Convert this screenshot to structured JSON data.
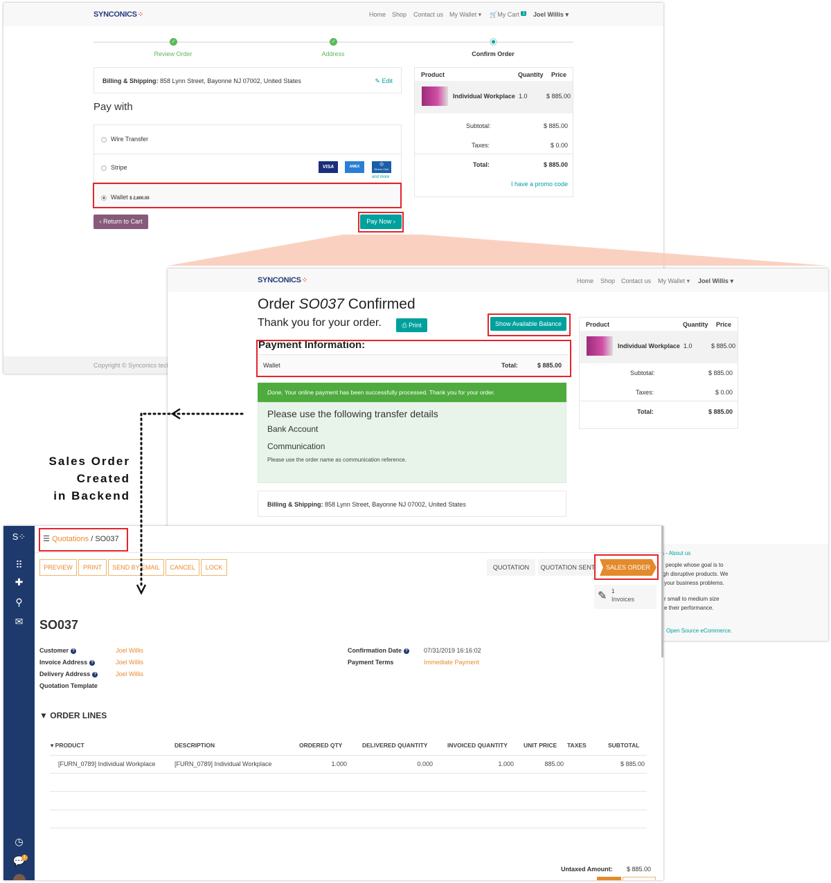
{
  "colors": {
    "accent_teal": "#00a09d",
    "success_green": "#5cb85c",
    "odoo_purple": "#875a7b",
    "backend_orange": "#e88a2e",
    "sidebar_navy": "#1e3a6d",
    "highlight_red": "#e5232b",
    "zoom_callout": "#f9c9b5"
  },
  "annotation": {
    "line1": "Sales Order",
    "line2": "Created",
    "line3": "in Backend"
  },
  "checkout": {
    "logo": "SYNCONICS",
    "nav": {
      "home": "Home",
      "shop": "Shop",
      "contact": "Contact us",
      "wallet": "My Wallet",
      "cart": "My Cart",
      "cart_count": "1",
      "user": "Joel Willis"
    },
    "steps": [
      {
        "label": "Review Order",
        "state": "done"
      },
      {
        "label": "Address",
        "state": "done"
      },
      {
        "label": "Confirm Order",
        "state": "current"
      }
    ],
    "billing_label": "Billing & Shipping:",
    "billing_address": "858 Lynn Street, Bayonne NJ 07002, United States",
    "edit": "Edit",
    "pay_with": "Pay with",
    "methods": [
      {
        "label": "Wire Transfer",
        "selected": false
      },
      {
        "label": "Stripe",
        "selected": false,
        "cards": [
          "VISA",
          "AMEX",
          "Diners Club"
        ],
        "more": "and more"
      },
      {
        "label": "Wallet",
        "balance": "$ 2,600.00",
        "selected": true
      }
    ],
    "return_btn": "Return to Cart",
    "pay_btn": "Pay Now",
    "summary": {
      "h_product": "Product",
      "h_qty": "Quantity",
      "h_price": "Price",
      "product": "Individual Workplace",
      "qty": "1.0",
      "price": "$ 885.00",
      "subtotal_l": "Subtotal:",
      "subtotal": "$ 885.00",
      "taxes_l": "Taxes:",
      "taxes": "$ 0.00",
      "total_l": "Total:",
      "total": "$ 885.00",
      "promo": "I have a promo code"
    },
    "footer": "Copyright © Synconics tech"
  },
  "confirmation": {
    "logo": "SYNCONICS",
    "nav": {
      "home": "Home",
      "shop": "Shop",
      "contact": "Contact us",
      "wallet": "My Wallet",
      "user": "Joel Willis"
    },
    "title_pre": "Order",
    "title_ref": "SO037",
    "title_post": "Confirmed",
    "thanks": "Thank you for your order.",
    "print": "Print",
    "balance_btn": "Show Available Balance",
    "payment_info": "Payment Information:",
    "method": "Wallet",
    "total_l": "Total:",
    "total": "$ 885.00",
    "alert_em": "Done,",
    "alert": "Your online payment has been successfully processed. Thank you for your order.",
    "transfer_title": "Please use the following transfer details",
    "bank": "Bank Account",
    "communication": "Communication",
    "comm_note": "Please use the order name as communication reference.",
    "billing_label": "Billing & Shipping:",
    "billing_address": "858 Lynn Street, Bayonne NJ 07002, United States",
    "summary": {
      "h_product": "Product",
      "h_qty": "Quantity",
      "h_price": "Price",
      "product": "Individual Workplace",
      "qty": "1.0",
      "price": "$ 885.00",
      "subtotal_l": "Subtotal:",
      "subtotal": "$ 885.00",
      "taxes_l": "Taxes:",
      "taxes": "$ 0.00",
      "total_l": "Total:",
      "total": "$ 885.00"
    },
    "footer_lines": [
      "s - ",
      "About us",
      "people whose goal is to",
      "gh disruptive products. We",
      "your business problems.",
      "r small to medium size",
      "e their performance.",
      "Open Source eCommerce."
    ]
  },
  "backend": {
    "breadcrumb_parent": "Quotations",
    "breadcrumb_sep": "/",
    "breadcrumb_current": "SO037",
    "buttons": [
      "PREVIEW",
      "PRINT",
      "SEND BY EMAIL",
      "CANCEL",
      "LOCK"
    ],
    "stages": [
      {
        "label": "QUOTATION",
        "active": false
      },
      {
        "label": "QUOTATION SENT",
        "active": false
      },
      {
        "label": "SALES ORDER",
        "active": true
      }
    ],
    "invoices_count": "1",
    "invoices_label": "Invoices",
    "record": "SO037",
    "fields_left": [
      {
        "label": "Customer",
        "help": true,
        "value": "Joel Willis"
      },
      {
        "label": "Invoice Address",
        "help": true,
        "value": "Joel Willis"
      },
      {
        "label": "Delivery Address",
        "help": true,
        "value": "Joel Willis"
      },
      {
        "label": "Quotation Template",
        "help": false,
        "value": ""
      }
    ],
    "fields_right": [
      {
        "label": "Confirmation Date",
        "help": true,
        "value": "07/31/2019 16:16:02",
        "plain": true
      },
      {
        "label": "Payment Terms",
        "help": false,
        "value": "Immediate Payment"
      }
    ],
    "section": "ORDER LINES",
    "columns": [
      "PRODUCT",
      "DESCRIPTION",
      "ORDERED QTY",
      "DELIVERED QUANTITY",
      "INVOICED QUANTITY",
      "UNIT PRICE",
      "TAXES",
      "SUBTOTAL"
    ],
    "rows": [
      [
        "[FURN_0789] Individual Workplace",
        "[FURN_0789] Individual Workplace",
        "1.000",
        "0.000",
        "1.000",
        "885.00",
        "",
        "$ 885.00"
      ]
    ],
    "untaxed_l": "Untaxed Amount:",
    "untaxed": "$ 885.00",
    "chat_badge": "1"
  }
}
